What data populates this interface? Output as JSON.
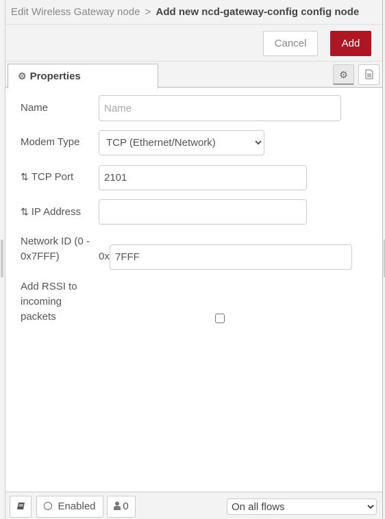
{
  "breadcrumb": {
    "previous": "Edit Wireless Gateway node",
    "separator": ">",
    "current": "Add new ncd-gateway-config config node"
  },
  "toolbar": {
    "cancel_label": "Cancel",
    "add_label": "Add",
    "accent_color": "#ad1625"
  },
  "tabs": {
    "properties_label": "Properties",
    "properties_icon": "gear-icon",
    "node_properties_icon": "gear-icon",
    "node_description_icon": "document-icon"
  },
  "form": {
    "name": {
      "label": "Name",
      "value": "",
      "placeholder": "Name"
    },
    "modem_type": {
      "label": "Modem Type",
      "selected": "TCP (Ethernet/Network)"
    },
    "tcp_port": {
      "label": "TCP Port",
      "icon": "shuffle-icon",
      "value": "2101"
    },
    "ip_address": {
      "label": "IP Address",
      "icon": "shuffle-icon",
      "value": ""
    },
    "network_id": {
      "label_line1": "Network ID (0 -",
      "label_line2": "0x7FFF)",
      "prefix": "0x",
      "value": "7FFF"
    },
    "rssi": {
      "label_line1": "Add RSSI to",
      "label_line2": "incoming",
      "label_line3": "packets",
      "checked": false
    }
  },
  "footer": {
    "book_icon": "book-icon",
    "enabled_label": "Enabled",
    "users_count": "0",
    "users_icon": "user-icon",
    "scope_selected": "On all flows"
  }
}
